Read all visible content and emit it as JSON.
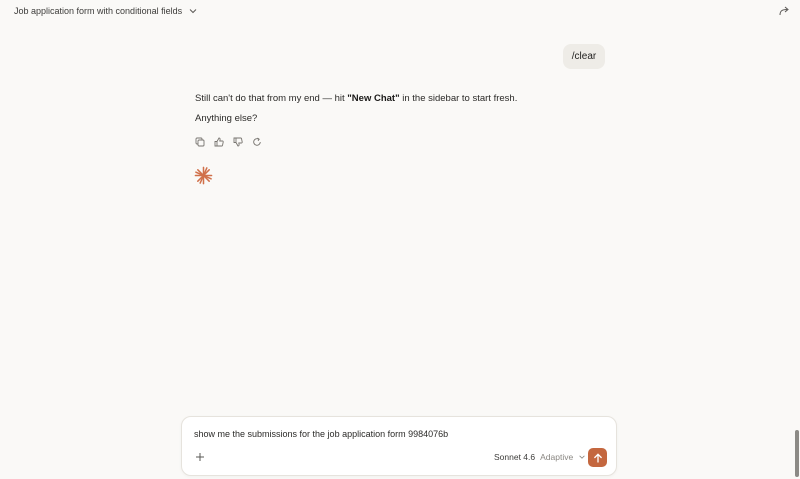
{
  "header": {
    "title": "Job application form with conditional fields",
    "chevron_icon": "chevron-down-icon",
    "share_icon": "share-icon"
  },
  "conversation": {
    "user_message": "/clear",
    "assistant": {
      "line1_pre": "Still can't do that from my end — hit ",
      "line1_bold": "\"New Chat\"",
      "line1_post": " in the sidebar to start fresh.",
      "line2": "Anything else?"
    },
    "actions": [
      "copy-icon",
      "thumbs-up-icon",
      "thumbs-down-icon",
      "retry-icon"
    ]
  },
  "composer": {
    "value": "show me the submissions for the job application form 9984076b",
    "model": "Sonnet 4.6",
    "mode": "Adaptive"
  },
  "colors": {
    "accent": "#c4673f",
    "background": "#faf9f7",
    "user_bubble": "#eeece7"
  }
}
